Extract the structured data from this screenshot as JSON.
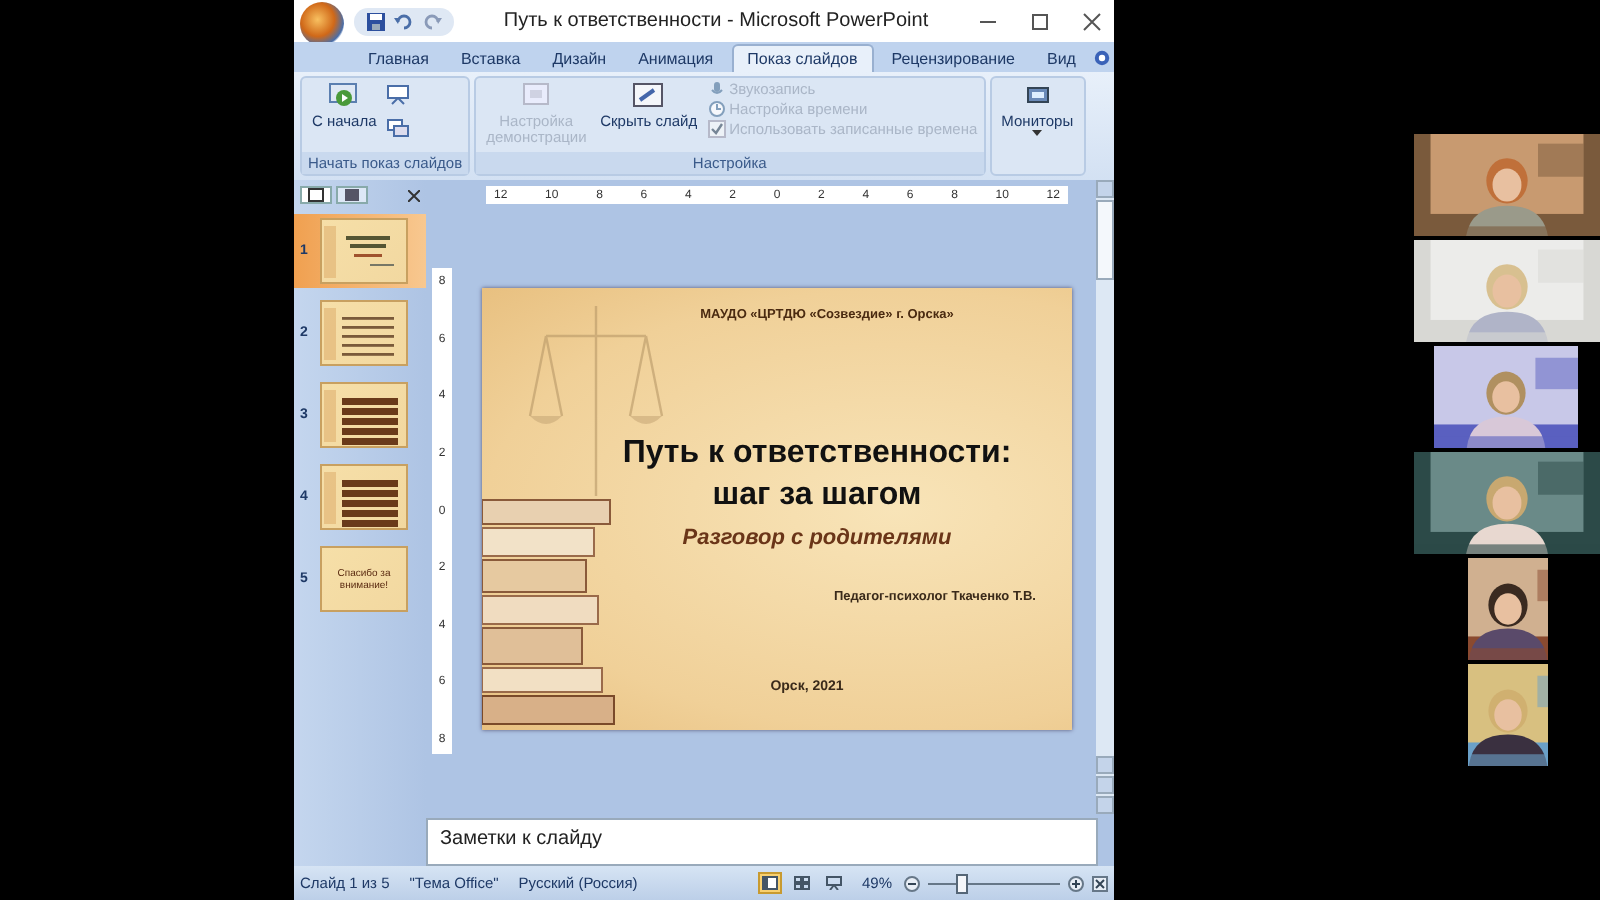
{
  "window": {
    "title": "Путь к ответственности - Microsoft PowerPoint"
  },
  "tabs": [
    {
      "label": "Главная",
      "selected": false
    },
    {
      "label": "Вставка",
      "selected": false
    },
    {
      "label": "Дизайн",
      "selected": false
    },
    {
      "label": "Анимация",
      "selected": false
    },
    {
      "label": "Показ слайдов",
      "selected": true
    },
    {
      "label": "Рецензирование",
      "selected": false
    },
    {
      "label": "Вид",
      "selected": false
    }
  ],
  "ribbon": {
    "groups": [
      {
        "label": "Начать показ слайдов",
        "items": [
          {
            "kind": "large",
            "label": "С начала",
            "disabled": false
          },
          {
            "kind": "icon",
            "disabled": false
          },
          {
            "kind": "icon",
            "disabled": false
          }
        ]
      },
      {
        "label": "Настройка",
        "items": [
          {
            "kind": "large",
            "label": "Настройка демонстрации",
            "disabled": true
          },
          {
            "kind": "large",
            "label": "Скрыть слайд",
            "disabled": false
          },
          {
            "kind": "small",
            "label": "Звукозапись",
            "disabled": true
          },
          {
            "kind": "small",
            "label": "Настройка времени",
            "disabled": true
          },
          {
            "kind": "check",
            "label": "Использовать записанные времена",
            "checked": true,
            "disabled": true
          }
        ]
      },
      {
        "items": [
          {
            "kind": "large",
            "label": "Мониторы",
            "disabled": false,
            "dropdown": true
          }
        ]
      }
    ]
  },
  "slides": [
    {
      "number": "1",
      "selected": true,
      "kind": "title"
    },
    {
      "number": "2",
      "selected": false,
      "kind": "text"
    },
    {
      "number": "3",
      "selected": false,
      "kind": "list"
    },
    {
      "number": "4",
      "selected": false,
      "kind": "list"
    },
    {
      "number": "5",
      "selected": false,
      "kind": "end",
      "text": "Спасибо за внимание!"
    }
  ],
  "ruler": {
    "horizontal": [
      "12",
      "10",
      "8",
      "6",
      "4",
      "2",
      "0",
      "2",
      "4",
      "6",
      "8",
      "10",
      "12"
    ],
    "vertical": [
      "8",
      "6",
      "4",
      "2",
      "0",
      "2",
      "4",
      "6",
      "8"
    ]
  },
  "slide": {
    "header": "МАУДО «ЦРТДЮ «Созвездие» г. Орска»",
    "title": [
      "Путь к ответственности:",
      "шаг за шагом"
    ],
    "subtitle": "Разговор с родителями",
    "author": "Педагог-психолог Ткаченко Т.В.",
    "footer": "Орск, 2021"
  },
  "notes": {
    "placeholder": "Заметки к слайду"
  },
  "status_bar": {
    "slide": "Слайд 1 из 5",
    "theme": "\"Тема Office\"",
    "language": "Русский (Россия)",
    "views": [
      {
        "kind": "normal",
        "selected": true
      },
      {
        "kind": "sorter",
        "selected": false
      },
      {
        "kind": "show",
        "selected": false
      }
    ],
    "zoom": {
      "label": "49%",
      "level": 0.22
    }
  }
}
